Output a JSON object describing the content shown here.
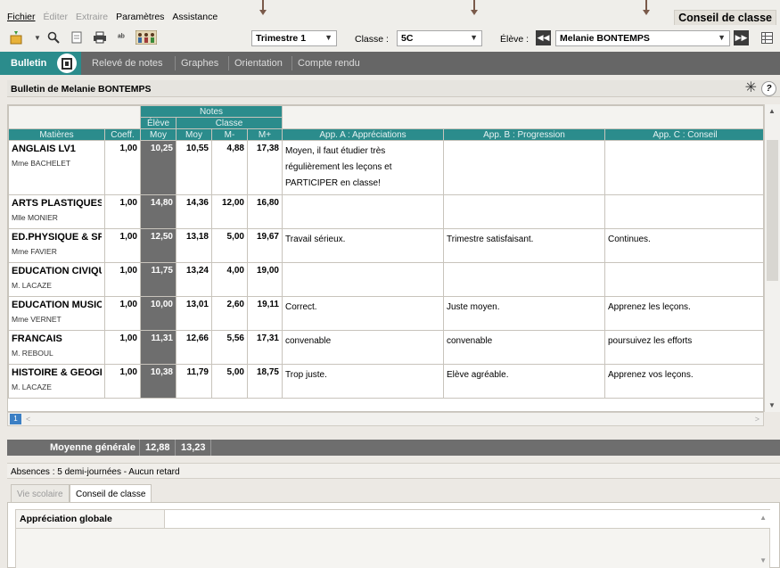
{
  "menu": {
    "items": [
      {
        "label": "Fichier",
        "enabled": true
      },
      {
        "label": "Éditer",
        "enabled": false
      },
      {
        "label": "Extraire",
        "enabled": false
      },
      {
        "label": "Paramètres",
        "enabled": true
      },
      {
        "label": "Assistance",
        "enabled": true
      }
    ],
    "mode_title": "Conseil de classe"
  },
  "toolbar": {
    "periode": "Trimestre 1",
    "classe_label": "Classe :",
    "classe": "5C",
    "eleve_label": "Élève :",
    "eleve": "Melanie BONTEMPS"
  },
  "tabs": [
    {
      "label": "Bulletin",
      "active": true
    },
    {
      "label": "Relevé de notes",
      "active": false
    },
    {
      "label": "Graphes",
      "active": false
    },
    {
      "label": "Orientation",
      "active": false
    },
    {
      "label": "Compte rendu",
      "active": false
    }
  ],
  "panel": {
    "title": "Bulletin de Melanie BONTEMPS",
    "help": "?"
  },
  "grid": {
    "group_notes": "Notes",
    "group_eleve": "Élève",
    "group_classe": "Classe",
    "headers": [
      "Matières",
      "Coeff.",
      "Moy",
      "Moy",
      "M-",
      "M+",
      "App. A : Appréciations",
      "App. B : Progression",
      "App. C : Conseil"
    ],
    "rows": [
      {
        "matiere": "ANGLAIS LV1",
        "prof": "Mme BACHELET",
        "coeff": "1,00",
        "eleve_moy": "10,25",
        "classe_moy": "10,55",
        "min": "4,88",
        "max": "17,38",
        "app_a": "Moyen, il faut étudier très régulièrement les leçons et PARTICIPER en classe!",
        "app_b": "",
        "app_c": ""
      },
      {
        "matiere": "ARTS PLASTIQUES",
        "prof": "Mlle MONIER",
        "coeff": "1,00",
        "eleve_moy": "14,80",
        "classe_moy": "14,36",
        "min": "12,00",
        "max": "16,80",
        "app_a": "",
        "app_b": "",
        "app_c": ""
      },
      {
        "matiere": "ED.PHYSIQUE & SP",
        "prof": "Mme FAVIER",
        "coeff": "1,00",
        "eleve_moy": "12,50",
        "classe_moy": "13,18",
        "min": "5,00",
        "max": "19,67",
        "app_a": "Travail sérieux.",
        "app_b": "Trimestre satisfaisant.",
        "app_c": "Continues."
      },
      {
        "matiere": "EDUCATION CIVIQU",
        "prof": "M. LACAZE",
        "coeff": "1,00",
        "eleve_moy": "11,75",
        "classe_moy": "13,24",
        "min": "4,00",
        "max": "19,00",
        "app_a": "",
        "app_b": "",
        "app_c": ""
      },
      {
        "matiere": "EDUCATION MUSIC.",
        "prof": "Mme VERNET",
        "coeff": "1,00",
        "eleve_moy": "10,00",
        "classe_moy": "13,01",
        "min": "2,60",
        "max": "19,11",
        "app_a": "Correct.",
        "app_b": "Juste moyen.",
        "app_c": "Apprenez les leçons."
      },
      {
        "matiere": "FRANCAIS",
        "prof": "M. REBOUL",
        "coeff": "1,00",
        "eleve_moy": "11,31",
        "classe_moy": "12,66",
        "min": "5,56",
        "max": "17,31",
        "app_a": "convenable",
        "app_b": "convenable",
        "app_c": "poursuivez les efforts"
      },
      {
        "matiere": "HISTOIRE & GEOGR",
        "prof": "M. LACAZE",
        "coeff": "1,00",
        "eleve_moy": "10,38",
        "classe_moy": "11,79",
        "min": "5,00",
        "max": "18,75",
        "app_a": "Trop juste.",
        "app_b": "Elève agréable.",
        "app_c": "Apprenez vos leçons."
      }
    ],
    "page": "1"
  },
  "moyenne": {
    "label": "Moyenne générale",
    "eleve": "12,88",
    "classe": "13,23"
  },
  "absences": "Absences : 5 demi-journées - Aucun retard",
  "subtabs": [
    {
      "label": "Vie scolaire",
      "active": false
    },
    {
      "label": "Conseil de classe",
      "active": true
    }
  ],
  "appreciation": {
    "label": "Appréciation globale",
    "value": ""
  },
  "colors": {
    "teal": "#2b8c8c",
    "tab_bar": "#666666",
    "eleve_col": "#6e6e6e",
    "pointer": "#7a5a4a"
  }
}
